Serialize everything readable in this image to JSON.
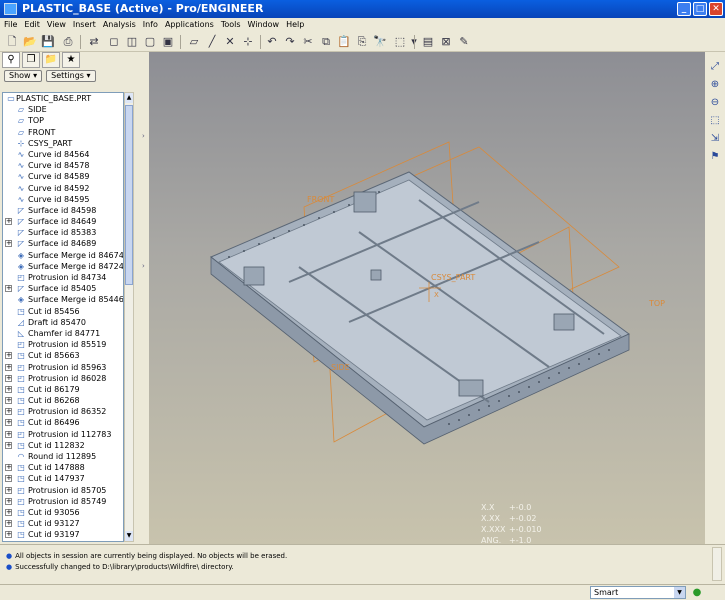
{
  "window": {
    "title": "PLASTIC_BASE (Active) - Pro/ENGINEER"
  },
  "menu": [
    "File",
    "Edit",
    "View",
    "Insert",
    "Analysis",
    "Info",
    "Applications",
    "Tools",
    "Window",
    "Help"
  ],
  "left_panel": {
    "show_button": "Show",
    "settings_button": "Settings",
    "root": "PLASTIC_BASE.PRT",
    "items": [
      {
        "label": "SIDE",
        "icon": "datum-plane-icon",
        "expandable": false
      },
      {
        "label": "TOP",
        "icon": "datum-plane-icon",
        "expandable": false
      },
      {
        "label": "FRONT",
        "icon": "datum-plane-icon",
        "expandable": false
      },
      {
        "label": "CSYS_PART",
        "icon": "csys-icon",
        "expandable": false
      },
      {
        "label": "Curve id 84564",
        "icon": "curve-icon",
        "expandable": false
      },
      {
        "label": "Curve id 84578",
        "icon": "curve-icon",
        "expandable": false
      },
      {
        "label": "Curve id 84589",
        "icon": "curve-icon",
        "expandable": false
      },
      {
        "label": "Curve id 84592",
        "icon": "curve-icon",
        "expandable": false
      },
      {
        "label": "Curve id 84595",
        "icon": "curve-icon",
        "expandable": false
      },
      {
        "label": "Surface id 84598",
        "icon": "surface-icon",
        "expandable": false
      },
      {
        "label": "Surface id 84649",
        "icon": "surface-icon",
        "expandable": true
      },
      {
        "label": "Surface id 85383",
        "icon": "surface-icon",
        "expandable": false
      },
      {
        "label": "Surface id 84689",
        "icon": "surface-icon",
        "expandable": true
      },
      {
        "label": "Surface Merge id 84674",
        "icon": "merge-icon",
        "expandable": false
      },
      {
        "label": "Surface Merge id 84724",
        "icon": "merge-icon",
        "expandable": false
      },
      {
        "label": "Protrusion id 84734",
        "icon": "protrusion-icon",
        "expandable": false
      },
      {
        "label": "Surface id 85405",
        "icon": "surface-icon",
        "expandable": true
      },
      {
        "label": "Surface Merge id 85446",
        "icon": "merge-icon",
        "expandable": false
      },
      {
        "label": "Cut id 85456",
        "icon": "cut-icon",
        "expandable": false
      },
      {
        "label": "Draft id 85470",
        "icon": "draft-icon",
        "expandable": false
      },
      {
        "label": "Chamfer id 84771",
        "icon": "chamfer-icon",
        "expandable": false
      },
      {
        "label": "Protrusion id 85519",
        "icon": "protrusion-icon",
        "expandable": false
      },
      {
        "label": "Cut id 85663",
        "icon": "cut-icon",
        "expandable": true
      },
      {
        "label": "Protrusion id 85963",
        "icon": "protrusion-icon",
        "expandable": true
      },
      {
        "label": "Protrusion id 86028",
        "icon": "protrusion-icon",
        "expandable": true
      },
      {
        "label": "Cut id 86179",
        "icon": "cut-icon",
        "expandable": true
      },
      {
        "label": "Cut id 86268",
        "icon": "cut-icon",
        "expandable": true
      },
      {
        "label": "Protrusion id 86352",
        "icon": "protrusion-icon",
        "expandable": true
      },
      {
        "label": "Cut id 86496",
        "icon": "cut-icon",
        "expandable": true
      },
      {
        "label": "Protrusion id 112783",
        "icon": "protrusion-icon",
        "expandable": true
      },
      {
        "label": "Cut id 112832",
        "icon": "cut-icon",
        "expandable": true
      },
      {
        "label": "Round id 112895",
        "icon": "round-icon",
        "expandable": false
      },
      {
        "label": "Cut id 147888",
        "icon": "cut-icon",
        "expandable": true
      },
      {
        "label": "Cut id 147937",
        "icon": "cut-icon",
        "expandable": true
      },
      {
        "label": "Protrusion id 85705",
        "icon": "protrusion-icon",
        "expandable": true
      },
      {
        "label": "Protrusion id 85749",
        "icon": "protrusion-icon",
        "expandable": true
      },
      {
        "label": "Cut id 93056",
        "icon": "cut-icon",
        "expandable": true
      },
      {
        "label": "Cut id 93127",
        "icon": "cut-icon",
        "expandable": true
      },
      {
        "label": "Cut id 93197",
        "icon": "cut-icon",
        "expandable": true
      }
    ]
  },
  "graphics": {
    "datum_labels": {
      "front": "FRONT",
      "top": "TOP",
      "side": "SIDE",
      "csys": "CSYS_PART",
      "csys_axis": "X"
    },
    "tolerances": [
      {
        "label": "X.X",
        "value": "+-0.0"
      },
      {
        "label": "X.XX",
        "value": "+-0.02"
      },
      {
        "label": "X.XXX",
        "value": "+-0.010"
      },
      {
        "label": "ANG.",
        "value": "+-1.0"
      }
    ],
    "colors": {
      "part": "#b9c3cf",
      "datum": "#d98a3a"
    }
  },
  "messages": [
    "All objects in session are currently being displayed. No objects will be erased.",
    "Successfully changed to D:\\library\\products\\Wildfire\\ directory."
  ],
  "status": {
    "filter": "Smart"
  }
}
